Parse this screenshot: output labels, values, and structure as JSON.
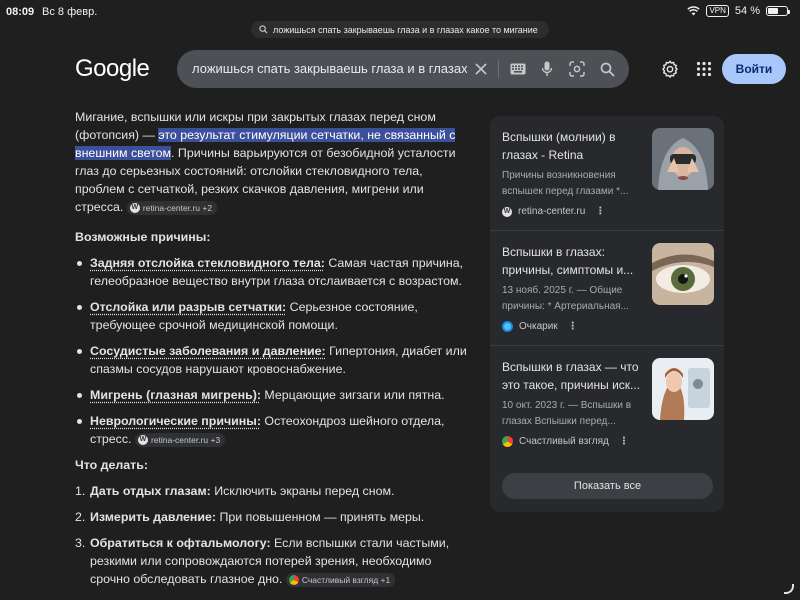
{
  "status": {
    "time": "08:09",
    "date": "Вс 8 февр.",
    "vpn": "VPN",
    "battery": "54 %",
    "battery_level": 0.54
  },
  "url": "ложишься спать закрываешь глаза и в глазах какое то мигание",
  "header": {
    "logo": "Google",
    "query": "ложишься спать закрываешь глаза и в глазах какое то мигание",
    "signin": "Войти"
  },
  "answer": {
    "intro_a": "Мигание, вспышки или искры при закрытых глазах перед сном (фотопсия) — ",
    "intro_hl": "это результат стимуляции сетчатки, не связанный с внешним светом",
    "intro_b": ". Причины варьируются от безобидной усталости глаз до серьезных состояний: отслойки стекловидного тела, проблем с сетчаткой, резких скачков давления, мигрени или стресса.",
    "intro_cite": "retina-center.ru +2",
    "causes_heading": "Возможные причины:",
    "causes": [
      {
        "term": "Задняя отслойка стекловидного тела:",
        "text": " Самая частая причина, гелеобразное вещество внутри глаза отслаивается с возрастом."
      },
      {
        "term": "Отслойка или разрыв сетчатки:",
        "text": " Серьезное состояние, требующее срочной медицинской помощи."
      },
      {
        "term": "Сосудистые заболевания и давление:",
        "text": " Гипертония, диабет или спазмы сосудов нарушают кровоснабжение."
      },
      {
        "term": "Мигрень (глазная мигрень):",
        "text": " Мерцающие зигзаги или пятна."
      },
      {
        "term": "Неврологические причины:",
        "text": " Остеохондроз шейного отдела, стресс.",
        "cite": "retina-center.ru +3"
      }
    ],
    "todo_heading": "Что делать:",
    "todo": [
      {
        "n": "1.",
        "term": "Дать отдых глазам:",
        "text": " Исключить экраны перед сном."
      },
      {
        "n": "2.",
        "term": "Измерить давление:",
        "text": " При повышенном — принять меры."
      },
      {
        "n": "3.",
        "term": "Обратиться к офтальмологу:",
        "text": " Если вспышки стали частыми, резкими или сопровождаются потерей зрения, необходимо срочно обследовать глазное дно.",
        "cite": "Счастливый взгляд +1"
      }
    ]
  },
  "panel": {
    "cards": [
      {
        "title": "Вспышки (молнии) в глазах - Retina",
        "desc": "Причины возникновения вспышек перед глазами *...",
        "source": "retina-center.ru",
        "dots": "⋮"
      },
      {
        "title": "Вспышки в глазах: причины, симптомы и...",
        "desc": "13 нояб. 2025 г. — Общие причины: * Артериальная...",
        "source": "Очкарик",
        "dots": "⋮"
      },
      {
        "title": "Вспышки в глазах — что это такое, причины иск...",
        "desc": "10 окт. 2023 г. — Вспышки в глазах Вспышки перед...",
        "source": "Счастливый взгляд",
        "dots": "⋮"
      }
    ],
    "show_all": "Показать все"
  }
}
